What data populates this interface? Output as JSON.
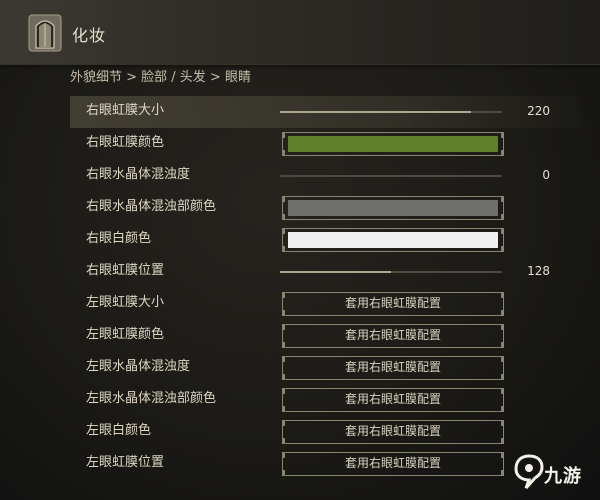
{
  "header": {
    "title": "化妆",
    "icon": "makeup-mirror-icon"
  },
  "breadcrumb": "外貌细节 > 脸部 / 头发 > 眼睛",
  "colors": {
    "right_iris_color": "#5f7f2b",
    "right_lens_clouding_color": "#6e6e6d",
    "right_white_color": "#efefef"
  },
  "rows": [
    {
      "label": "右眼虹膜大小",
      "type": "slider",
      "value": "220",
      "level": 0.86
    },
    {
      "label": "右眼虹膜颜色",
      "type": "color"
    },
    {
      "label": "右眼水晶体混浊度",
      "type": "slider",
      "value": "0",
      "level": 0.0
    },
    {
      "label": "右眼水晶体混浊部颜色",
      "type": "color"
    },
    {
      "label": "右眼白颜色",
      "type": "color"
    },
    {
      "label": "右眼虹膜位置",
      "type": "slider",
      "value": "128",
      "level": 0.5
    },
    {
      "label": "左眼虹膜大小",
      "type": "button",
      "button_label": "套用右眼虹膜配置"
    },
    {
      "label": "左眼虹膜颜色",
      "type": "button",
      "button_label": "套用右眼虹膜配置"
    },
    {
      "label": "左眼水晶体混浊度",
      "type": "button",
      "button_label": "套用右眼虹膜配置"
    },
    {
      "label": "左眼水晶体混浊部颜色",
      "type": "button",
      "button_label": "套用右眼虹膜配置"
    },
    {
      "label": "左眼白颜色",
      "type": "button",
      "button_label": "套用右眼虹膜配置"
    },
    {
      "label": "左眼虹膜位置",
      "type": "button",
      "button_label": "套用右眼虹膜配置"
    }
  ],
  "watermark": {
    "text": "九游",
    "icon": "jiuyou-logo-icon"
  }
}
